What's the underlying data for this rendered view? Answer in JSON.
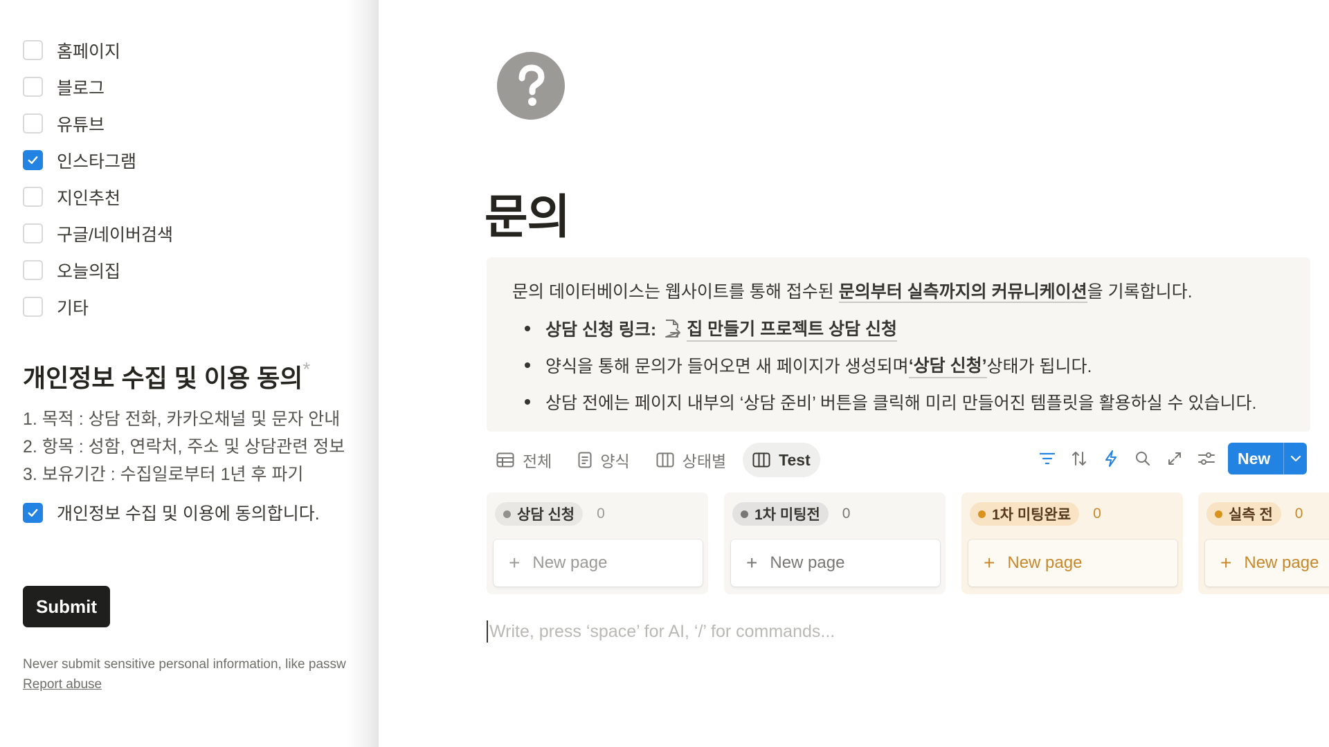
{
  "form": {
    "options": [
      {
        "label": "홈페이지",
        "checked": false
      },
      {
        "label": "블로그",
        "checked": false
      },
      {
        "label": "유튜브",
        "checked": false
      },
      {
        "label": "인스타그램",
        "checked": true
      },
      {
        "label": "지인추천",
        "checked": false
      },
      {
        "label": "구글/네이버검색",
        "checked": false
      },
      {
        "label": "오늘의집",
        "checked": false
      },
      {
        "label": "기타",
        "checked": false
      }
    ],
    "consent_title": "개인정보 수집 및 이용 동의",
    "required_mark": "*",
    "consent_lines": [
      "1. 목적 : 상담 전화, 카카오채널 및 문자 안내",
      "2. 항목 : 성함, 연락처, 주소 및 상담관련 정보",
      "3. 보유기간 : 수집일로부터 1년 후 파기"
    ],
    "agree_label": "개인정보 수집 및 이용에 동의합니다.",
    "agree_checked": true,
    "submit_label": "Submit",
    "disclaimer": "Never submit sensitive personal information, like passw",
    "report_label": "Report abuse"
  },
  "page": {
    "icon": "question-circle-icon",
    "title": "문의",
    "callout": {
      "intro_before": "문의 데이터베이스는 웹사이트를 통해 접수된 ",
      "intro_link": "문의부터 실측까지의 커뮤니케이션",
      "intro_after": "을 기록합니다.",
      "bullet1_label": "상담 신청 링크:",
      "bullet1_link": "집 만들기 프로젝트 상담 신청",
      "bullet2_before": "양식을 통해 문의가 들어오면 새 페이지가 생성되며 ",
      "bullet2_link": "‘상담 신청’",
      "bullet2_after": " 상태가 됩니다.",
      "bullet3": "상담 전에는 페이지 내부의 ‘상담 준비’ 버튼을 클릭해 미리 만들어진 템플릿을 활용하실 수 있습니다."
    },
    "tabs": [
      {
        "label": "전체",
        "icon": "table-icon"
      },
      {
        "label": "양식",
        "icon": "form-icon"
      },
      {
        "label": "상태별",
        "icon": "board-icon"
      },
      {
        "label": "Test",
        "icon": "board-icon",
        "active": true
      }
    ],
    "toolbar": {
      "new_label": "New"
    },
    "columns": [
      {
        "status": "상담 신청",
        "count": "0",
        "new_page": "New page",
        "bg": "#f7f6f3",
        "pill": "#e8e7e4",
        "dot": "#91918e",
        "text": "#37352f",
        "muted": "#9b9a97"
      },
      {
        "status": "1차 미팅전",
        "count": "0",
        "new_page": "New page",
        "bg": "#f7f6f3",
        "pill": "#e3e2e0",
        "dot": "#787774",
        "text": "#37352f",
        "muted": "#787774"
      },
      {
        "status": "1차 미팅완료",
        "count": "0",
        "new_page": "New page",
        "bg": "#fbf3e6",
        "pill": "#f8e3c4",
        "dot": "#d9921a",
        "text": "#55391a",
        "muted": "#c8882a"
      },
      {
        "status": "실측 전",
        "count": "0",
        "new_page": "New page",
        "bg": "#fbf3e6",
        "pill": "#f8e3c4",
        "dot": "#d9921a",
        "text": "#55391a",
        "muted": "#c8882a"
      }
    ],
    "editor_placeholder": "Write, press ‘space’ for AI, ‘/’ for commands..."
  },
  "colors": {
    "accent": "#2383e2",
    "submit": "#1f1f1d",
    "callout_bg": "#f7f6f3"
  }
}
